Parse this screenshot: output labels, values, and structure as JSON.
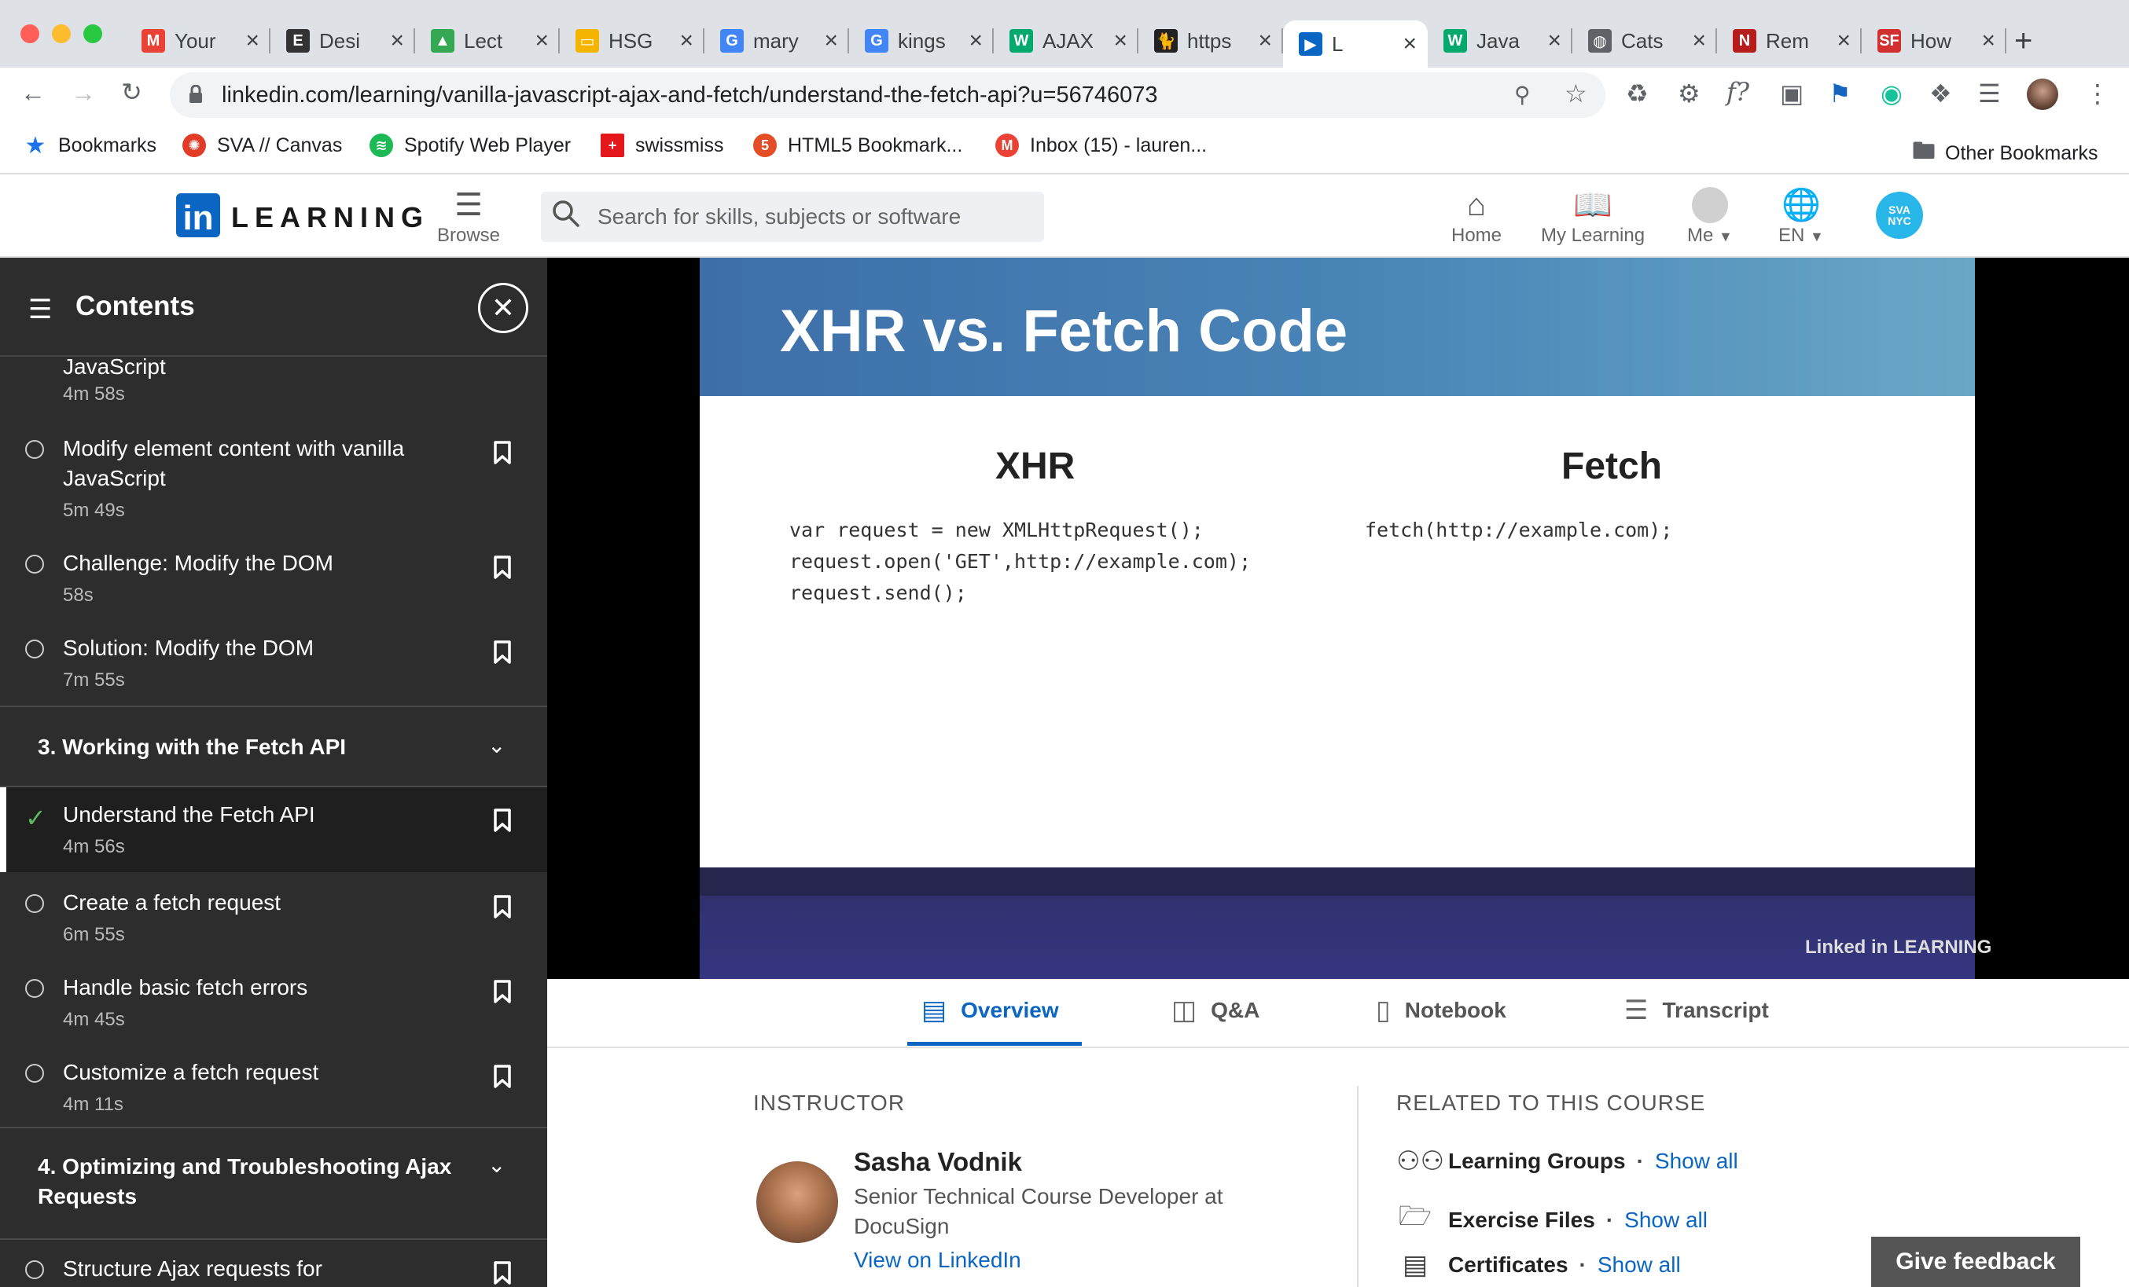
{
  "browser": {
    "tabs": [
      {
        "label": "Your",
        "favicon": "gmail-icon",
        "color": "#ea4335"
      },
      {
        "label": "Desi",
        "favicon": "e-icon",
        "color": "#333333"
      },
      {
        "label": "Lect",
        "favicon": "drive-icon",
        "color": "#34a853"
      },
      {
        "label": "HSG",
        "favicon": "slides-icon",
        "color": "#f4b400"
      },
      {
        "label": "mary",
        "favicon": "google-icon",
        "color": "#4285f4"
      },
      {
        "label": "kings",
        "favicon": "google-icon",
        "color": "#4285f4"
      },
      {
        "label": "AJAX",
        "favicon": "w3schools-icon",
        "color": "#04aa6d"
      },
      {
        "label": "https",
        "favicon": "cat-icon",
        "color": "#222222"
      },
      {
        "label": "L",
        "favicon": "linkedin-learning-icon",
        "color": "#0a66c2",
        "active": true
      },
      {
        "label": "Java",
        "favicon": "w3schools-icon",
        "color": "#04aa6d"
      },
      {
        "label": "Cats",
        "favicon": "globe-icon",
        "color": "#5f6368"
      },
      {
        "label": "Rem",
        "favicon": "ne-icon",
        "color": "#b71c1c"
      },
      {
        "label": "How",
        "favicon": "sf-icon",
        "color": "#d32f2f"
      }
    ],
    "url": "linkedin.com/learning/vanilla-javascript-ajax-and-fetch/understand-the-fetch-api?u=56746073",
    "bookmarks": [
      {
        "label": "Bookmarks",
        "icon": "star-icon",
        "color": "#1a73e8"
      },
      {
        "label": "SVA // Canvas",
        "icon": "canvas-icon",
        "color": "#e13c28"
      },
      {
        "label": "Spotify Web Player",
        "icon": "spotify-icon",
        "color": "#1db954"
      },
      {
        "label": "swissmiss",
        "icon": "swiss-icon",
        "color": "#e3171c"
      },
      {
        "label": "HTML5 Bookmark...",
        "icon": "html5-icon",
        "color": "#e44d26"
      },
      {
        "label": "Inbox (15) - lauren...",
        "icon": "gmail-icon",
        "color": "#ea4335"
      }
    ],
    "other_bookmarks": "Other Bookmarks"
  },
  "header": {
    "logo_text": "LEARNING",
    "browse": "Browse",
    "search_placeholder": "Search for skills, subjects or software",
    "nav": {
      "home": "Home",
      "my_learning": "My Learning",
      "me": "Me",
      "lang": "EN"
    },
    "org_badge": "SVA NYC"
  },
  "sidebar": {
    "title": "Contents",
    "items": [
      {
        "title": "JavaScript",
        "duration": "4m 58s"
      },
      {
        "title": "Modify element content with vanilla JavaScript",
        "duration": "5m 49s"
      },
      {
        "title": "Challenge: Modify the DOM",
        "duration": "58s"
      },
      {
        "title": "Solution: Modify the DOM",
        "duration": "7m 55s"
      }
    ],
    "section3": "3. Working with the Fetch API",
    "section3_items": [
      {
        "title": "Understand the Fetch API",
        "duration": "4m 56s",
        "done": true
      },
      {
        "title": "Create a fetch request",
        "duration": "6m 55s"
      },
      {
        "title": "Handle basic fetch errors",
        "duration": "4m 45s"
      },
      {
        "title": "Customize a fetch request",
        "duration": "4m 11s"
      }
    ],
    "section4": "4. Optimizing and Troubleshooting Ajax Requests",
    "section4_items": [
      {
        "title": "Structure Ajax requests for"
      }
    ]
  },
  "slide": {
    "title": "XHR vs. Fetch Code",
    "left_heading": "XHR",
    "right_heading": "Fetch",
    "left_code": [
      "var request = new XMLHttpRequest();",
      "request.open('GET',http://example.com);",
      "request.send();"
    ],
    "right_code": [
      "fetch(http://example.com);"
    ],
    "brand": "Linked in LEARNING"
  },
  "content_tabs": {
    "overview": "Overview",
    "qa": "Q&A",
    "notebook": "Notebook",
    "transcript": "Transcript"
  },
  "instructor": {
    "label": "INSTRUCTOR",
    "name": "Sasha Vodnik",
    "title": "Senior Technical Course Developer at DocuSign",
    "link": "View on LinkedIn"
  },
  "related": {
    "label": "RELATED TO THIS COURSE",
    "items": [
      {
        "name": "Learning Groups",
        "action": "Show all",
        "icon": "group-icon"
      },
      {
        "name": "Exercise Files",
        "action": "Show all",
        "icon": "folder-icon"
      },
      {
        "name": "Certificates",
        "action": "Show all",
        "icon": "certificate-icon"
      }
    ]
  },
  "feedback": "Give feedback"
}
